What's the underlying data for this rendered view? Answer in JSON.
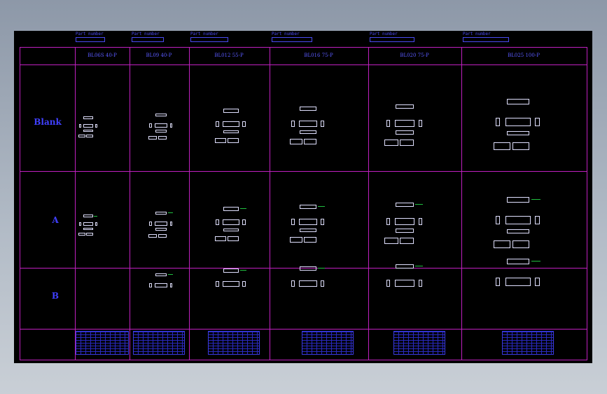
{
  "app": {
    "view": "CAD drawing model space"
  },
  "columns": [
    {
      "header_label": "Part number",
      "title": "BL06S 40-P"
    },
    {
      "header_label": "Part number",
      "title": "BL09 40-P"
    },
    {
      "header_label": "Part number",
      "title": "BL012 55-P"
    },
    {
      "header_label": "Part number",
      "title": "BL016 75-P"
    },
    {
      "header_label": "Part number",
      "title": "BL020 75-P"
    },
    {
      "header_label": "Part number",
      "title": "BL025 100-P"
    }
  ],
  "rows": [
    {
      "label": "Blank"
    },
    {
      "label": "A"
    },
    {
      "label": "B"
    }
  ],
  "colors": {
    "background": "#000000",
    "grid": "#c020c0",
    "lines": "#4a4af0",
    "accent": "#20c040"
  }
}
